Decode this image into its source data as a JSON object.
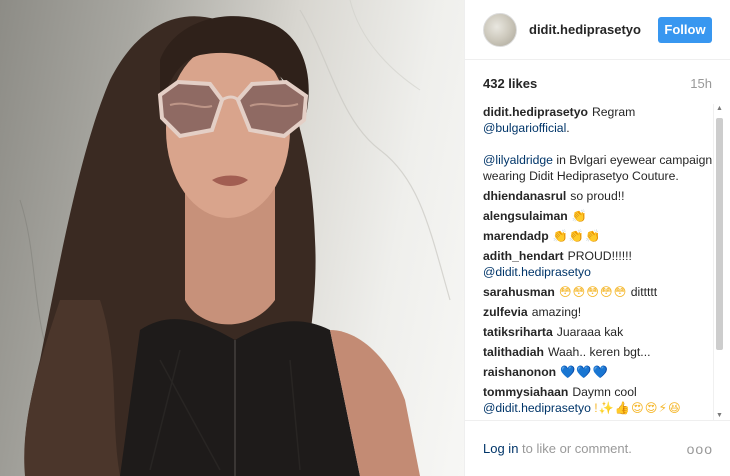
{
  "post": {
    "username": "didit.hediprasetyo",
    "follow_label": "Follow",
    "likes": "432 likes",
    "time": "15h"
  },
  "caption": {
    "username": "didit.hediprasetyo",
    "text1": "Regram",
    "mention1": "@bulgariofficial",
    "period": ".",
    "mention2": "@lilyaldridge",
    "text2": "in Bvlgari eyewear campaign wearing Didit Hediprasetyo Couture."
  },
  "comments": [
    {
      "user": "dhiendanasrul",
      "text": "so proud!!"
    },
    {
      "user": "alengsulaiman",
      "emoji": "👏"
    },
    {
      "user": "marendadp",
      "emoji": "👏👏👏"
    },
    {
      "user": "adith_hendart",
      "text": "PROUD!!!!!! ",
      "mention": "@didit.hediprasetyo"
    },
    {
      "user": "sarahusman",
      "emoji": "😳😳😳😳😳",
      "text": " dittttt"
    },
    {
      "user": "zulfevia",
      "text": "amazing!"
    },
    {
      "user": "tatiksriharta",
      "text": "Juaraaa kak"
    },
    {
      "user": "talithadiah",
      "text": "Waah.. keren bgt..."
    },
    {
      "user": "raishanonon",
      "emoji": "💙💙💙"
    },
    {
      "user": "tommysiahaan",
      "text": "Daymn cool",
      "mention": "@didit.hediprasetyo",
      "emoji": "!✨👍😍😍⚡😆"
    }
  ],
  "scroll": {
    "up": "▲",
    "down": "▼"
  },
  "footer": {
    "login_link": "Log in",
    "login_rest": " to like or comment.",
    "more": "ooo"
  },
  "icons": {
    "avatar": "profile-avatar",
    "more": "more-options-icon"
  }
}
